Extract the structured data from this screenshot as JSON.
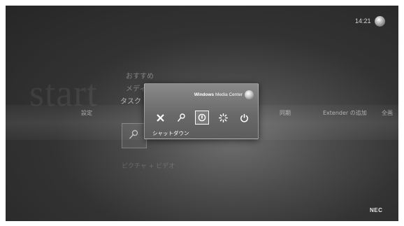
{
  "status": {
    "clock": "14:21"
  },
  "background": {
    "start_text": "start"
  },
  "menu": {
    "items": [
      "おすすめ",
      "メディ",
      "タスク"
    ]
  },
  "strip": {
    "items": [
      "設定",
      "同期",
      "Extender の追加",
      "全画"
    ]
  },
  "sub_item": "ピクチャ + ビデオ",
  "dialog": {
    "brand_bold": "Windows",
    "brand_rest": " Media Center",
    "buttons": [
      {
        "icon": "close-icon",
        "glyph": "✕"
      },
      {
        "icon": "key-icon",
        "glyph": "⚷"
      },
      {
        "icon": "shutdown-icon",
        "glyph": "⏻"
      },
      {
        "icon": "restart-icon",
        "glyph": "✲"
      },
      {
        "icon": "power-icon",
        "glyph": "⏻"
      }
    ],
    "selected_label": "シャットダウン"
  },
  "brand": {
    "oem": "NEC"
  },
  "colors": {
    "background": "#333333",
    "dialog": "#6a6a6a",
    "text": "#ffffff"
  }
}
